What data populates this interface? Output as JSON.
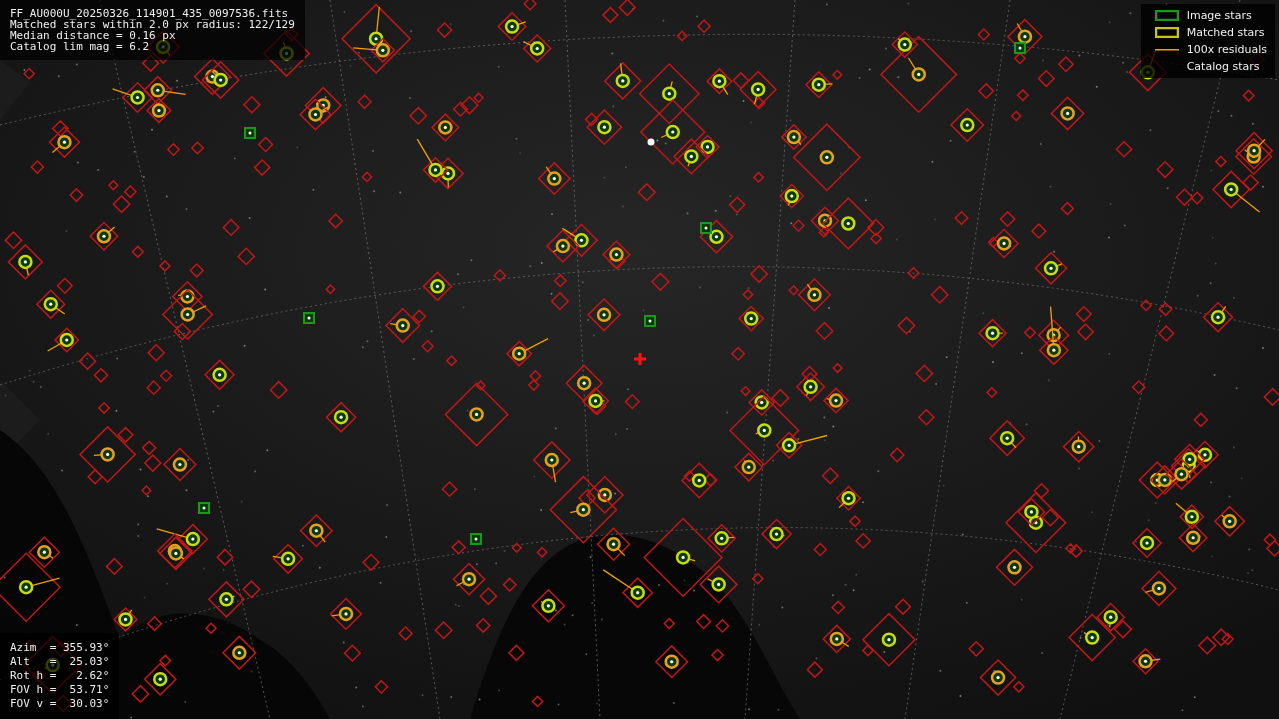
{
  "info": {
    "lines": [
      "FF_AU000U_20250326_114901_435_0097536.fits",
      "Matched stars within 2.0 px radius: 122/129",
      "Median distance = 0.16 px",
      "Catalog lim mag = 6.2"
    ]
  },
  "legend": {
    "items": [
      {
        "kind": "image",
        "label": "Image stars"
      },
      {
        "kind": "matched",
        "label": "Matched stars"
      },
      {
        "kind": "residual",
        "label": "100x residuals"
      },
      {
        "kind": "catalog",
        "label": "Catalog stars"
      }
    ]
  },
  "pointing": {
    "lines": [
      "Azim  = 355.93°",
      "Alt   =  25.03°",
      "Rot h =   2.62°",
      "FOV h =  53.71°",
      "FOV v =  30.03°"
    ]
  }
}
